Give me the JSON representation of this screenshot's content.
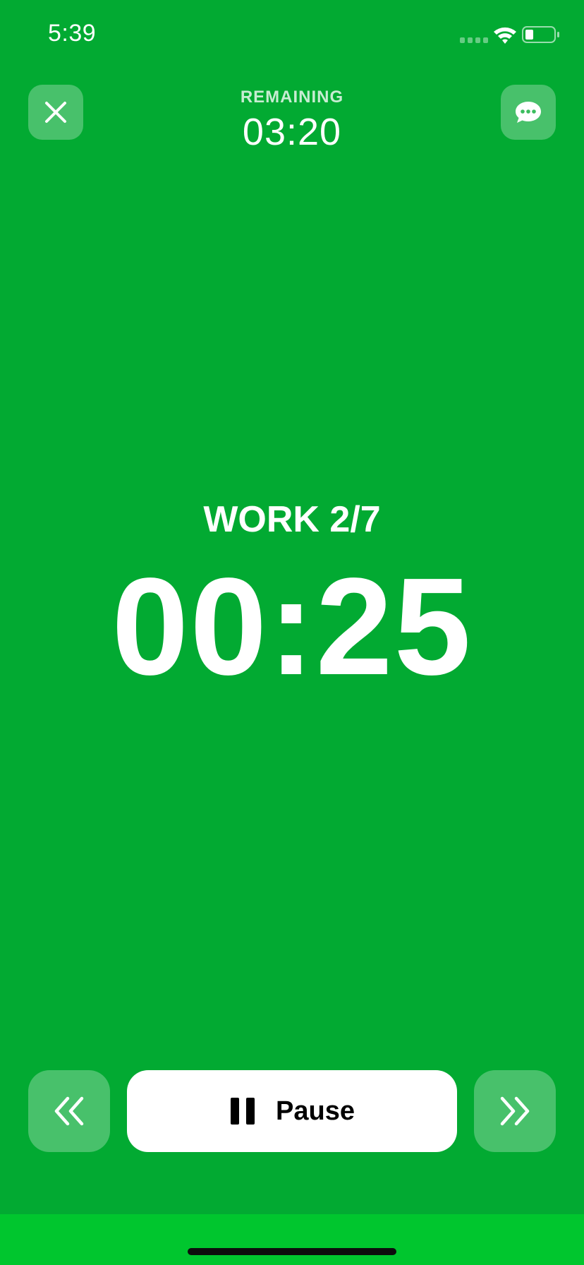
{
  "status_bar": {
    "time": "5:39",
    "icons": [
      "signal-icon",
      "wifi-icon",
      "battery-icon"
    ]
  },
  "header": {
    "close_icon": "close-icon",
    "chat_icon": "chat-bubble-icon",
    "remaining_label": "REMAINING",
    "remaining_time": "03:20"
  },
  "main": {
    "phase_label": "WORK 2/7",
    "interval_time": "00:25"
  },
  "controls": {
    "prev_icon": "double-chevron-left-icon",
    "pause_icon": "pause-icon",
    "pause_label": "Pause",
    "next_icon": "double-chevron-right-icon"
  },
  "colors": {
    "background": "#02aa32",
    "home_area": "#00c62e",
    "button_translucent": "rgba(255,255,255,0.28)",
    "pause_button": "#ffffff"
  }
}
